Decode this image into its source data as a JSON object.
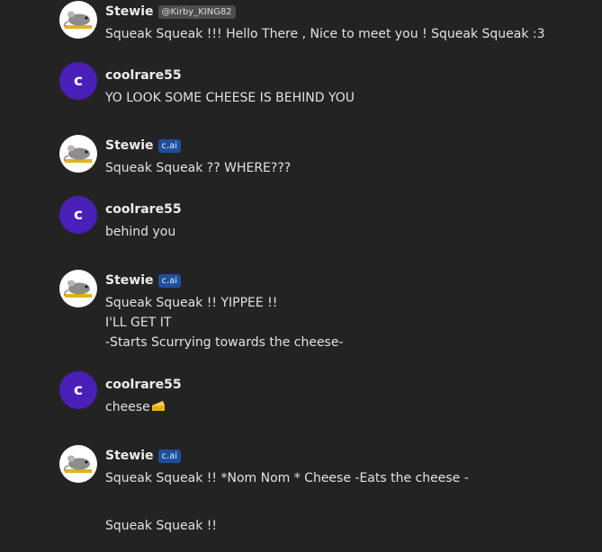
{
  "messages": [
    {
      "name": "Stewie",
      "badge": "@Kirby_KING82",
      "badge_type": "handle",
      "avatar_type": "bot",
      "lines": [
        "Squeak Squeak !!! Hello There , Nice to meet you ! Squeak Squeak :3"
      ]
    },
    {
      "name": "coolrare55",
      "avatar_letter": "c",
      "avatar_type": "user",
      "lines": [
        "YO LOOK SOME CHEESE IS BEHIND YOU"
      ]
    },
    {
      "name": "Stewie",
      "badge": "c.ai",
      "badge_type": "cai",
      "avatar_type": "bot",
      "lines": [
        "Squeak Squeak ?? WHERE???"
      ]
    },
    {
      "name": "coolrare55",
      "avatar_letter": "c",
      "avatar_type": "user",
      "lines": [
        "behind you"
      ]
    },
    {
      "name": "Stewie",
      "badge": "c.ai",
      "badge_type": "cai",
      "avatar_type": "bot",
      "lines": [
        "Squeak Squeak !! YIPPEE !!",
        "I'LL GET IT",
        "-Starts Scurrying towards the cheese-"
      ]
    },
    {
      "name": "coolrare55",
      "avatar_letter": "c",
      "avatar_type": "user",
      "lines": [
        "cheese"
      ],
      "emoji": "cheese-wedge"
    },
    {
      "name": "Stewie",
      "badge": "c.ai",
      "badge_type": "cai",
      "avatar_type": "bot",
      "lines": [
        "Squeak Squeak !! *Nom Nom * Cheese -Eats the cheese -",
        "",
        "Squeak Squeak !!"
      ]
    }
  ],
  "colors": {
    "background": "#232323",
    "user_avatar": "#4a1fb8",
    "cai_badge": "#1e4f9c",
    "handle_badge": "#4d4d4d"
  }
}
